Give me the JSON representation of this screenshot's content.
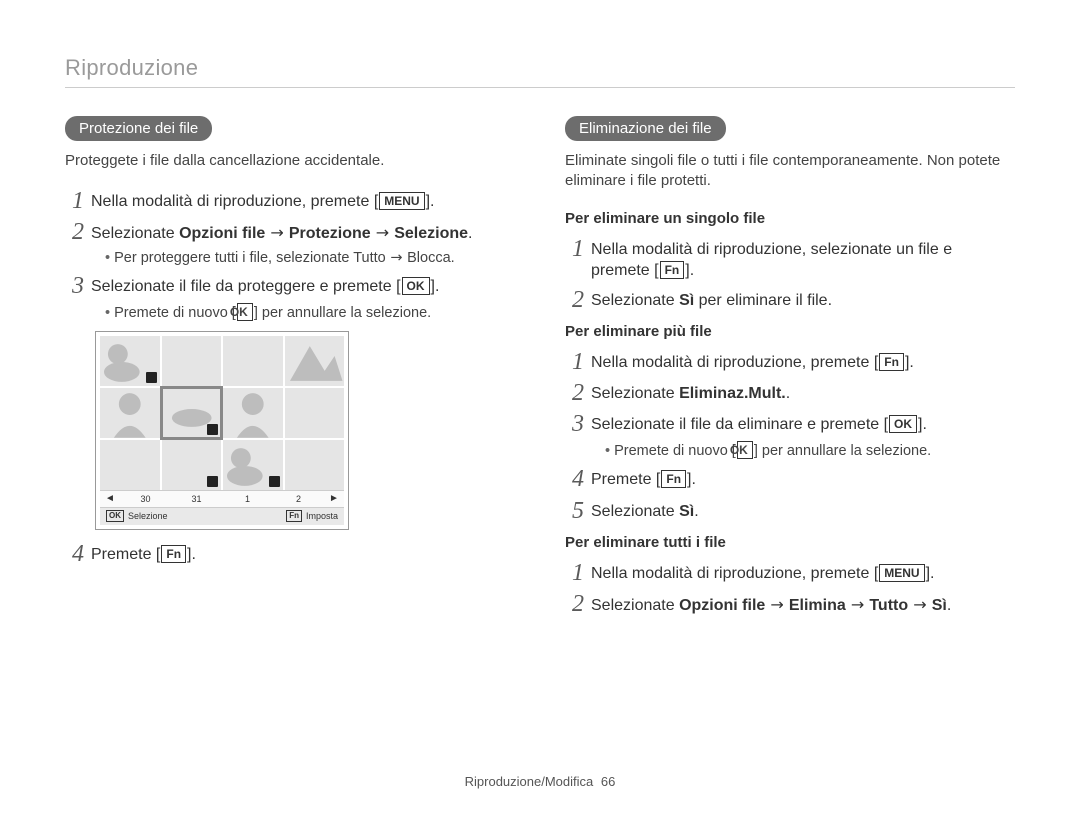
{
  "page_header": "Riproduzione",
  "footer": {
    "section": "Riproduzione/Modifica",
    "page_number": "66"
  },
  "left": {
    "pill": "Protezione dei file",
    "intro": "Proteggete i file dalla cancellazione accidentale.",
    "step1": {
      "num": "1",
      "pre": "Nella modalità di riproduzione, premete [",
      "key": "MENU",
      "post": "]."
    },
    "step2": {
      "num": "2",
      "pre": "Selezionate ",
      "b1": "Opzioni file",
      "arr1": " → ",
      "b2": "Protezione",
      "arr2": " → ",
      "b3": "Selezione",
      "post": "."
    },
    "step2_bullet": {
      "pre": "Per proteggere tutti i file, selezionate ",
      "b1": "Tutto",
      "arr": " → ",
      "b2": "Blocca",
      "post": "."
    },
    "step3": {
      "num": "3",
      "pre": "Selezionate il file da proteggere e premete [",
      "key": "OK",
      "post": "]."
    },
    "step3_bullet": {
      "pre": "Premete di nuovo [",
      "key": "OK",
      "post": "] per annullare la selezione."
    },
    "thumb": {
      "nums": [
        "30",
        "31",
        "1",
        "2"
      ],
      "ok_label": "Selezione",
      "fn_label": "Imposta",
      "ok_key": "OK",
      "fn_key": "Fn",
      "left_arrow": "◄",
      "right_arrow": "►"
    },
    "step4": {
      "num": "4",
      "pre": "Premete [",
      "key": "Fn",
      "post": "]."
    }
  },
  "right": {
    "pill": "Eliminazione dei file",
    "intro": "Eliminate singoli file o tutti i file contemporaneamente. Non potete eliminare i file protetti.",
    "h1": "Per eliminare un singolo file",
    "s1_step1": {
      "num": "1",
      "pre": "Nella modalità di riproduzione, selezionate un file e premete [",
      "key": "Fn",
      "post": "]."
    },
    "s1_step2": {
      "num": "2",
      "pre": "Selezionate ",
      "b": "Sì",
      "post": " per eliminare il file."
    },
    "h2": "Per eliminare più file",
    "s2_step1": {
      "num": "1",
      "pre": "Nella modalità di riproduzione, premete [",
      "key": "Fn",
      "post": "]."
    },
    "s2_step2": {
      "num": "2",
      "pre": "Selezionate ",
      "b": "Eliminaz.Mult.",
      "post": "."
    },
    "s2_step3": {
      "num": "3",
      "pre": "Selezionate il file da eliminare e premete [",
      "key": "OK",
      "post": "]."
    },
    "s2_step3_bullet": {
      "pre": "Premete di nuovo [",
      "key": "OK",
      "post": "] per annullare la selezione."
    },
    "s2_step4": {
      "num": "4",
      "pre": "Premete [",
      "key": "Fn",
      "post": "]."
    },
    "s2_step5": {
      "num": "5",
      "pre": "Selezionate ",
      "b": "Sì",
      "post": "."
    },
    "h3": "Per eliminare tutti i file",
    "s3_step1": {
      "num": "1",
      "pre": "Nella modalità di riproduzione, premete [",
      "key": "MENU",
      "post": "]."
    },
    "s3_step2": {
      "num": "2",
      "pre": "Selezionate ",
      "b1": "Opzioni file",
      "arr1": " → ",
      "b2": "Elimina",
      "arr2": " → ",
      "b3": "Tutto",
      "arr3": " → ",
      "b4": "Sì",
      "post": "."
    }
  }
}
